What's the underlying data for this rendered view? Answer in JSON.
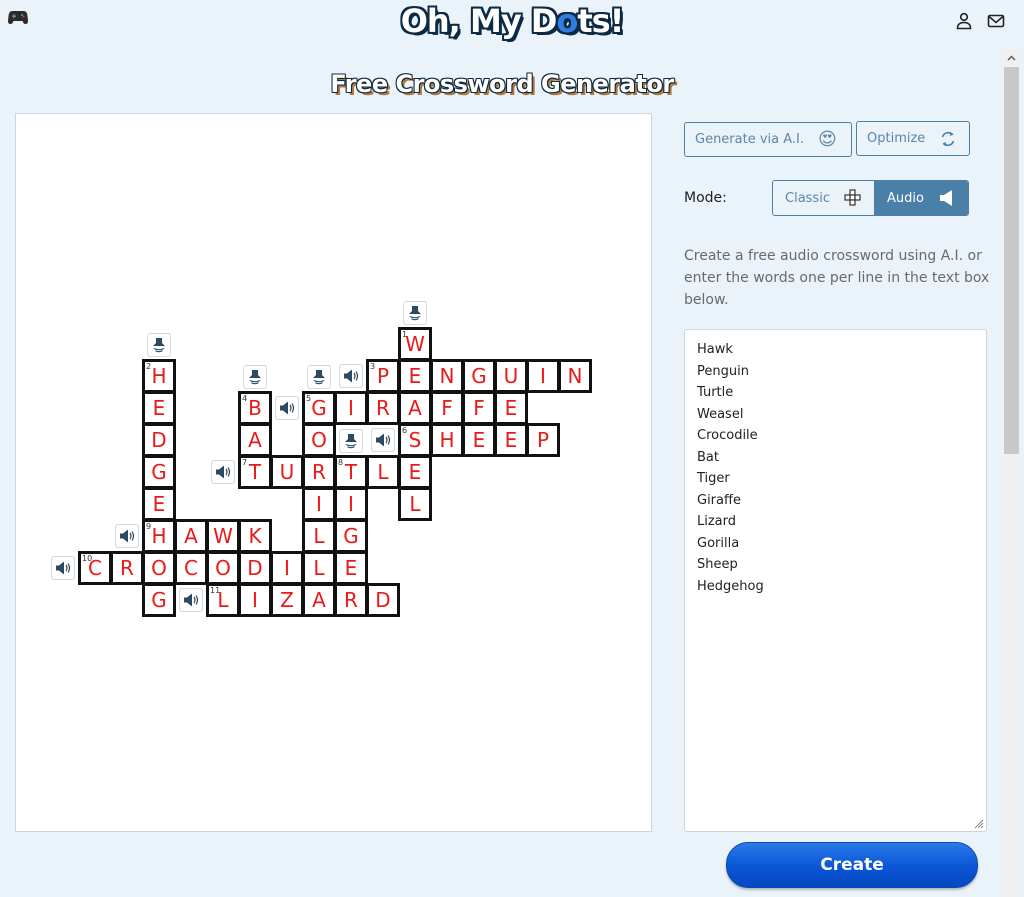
{
  "header": {
    "logo_parts": [
      "Oh, My D",
      "o",
      "ts!"
    ],
    "icons": [
      "gamepad-icon",
      "user-icon",
      "mail-icon"
    ]
  },
  "page_title": "Free Crossword Generator",
  "toolbar": {
    "generate_label": "Generate via A.I.",
    "generate_emoji": "😍",
    "optimize_label": "Optimize"
  },
  "mode": {
    "label": "Mode:",
    "options": [
      "Classic",
      "Audio"
    ],
    "selected": "Audio"
  },
  "description": "Create a free audio crossword using A.I. or enter the words one per line in the text box below.",
  "word_list": [
    "Hawk",
    "Penguin",
    "Turtle",
    "Weasel",
    "Crocodile",
    "Bat",
    "Tiger",
    "Giraffe",
    "Lizard",
    "Gorilla",
    "Sheep",
    "Hedgehog"
  ],
  "create_label": "Create",
  "colors": {
    "accent": "#4a7fa8",
    "letter": "#e81a1a",
    "create_button": "#0a55d6",
    "background": "#eaf2fa"
  },
  "crossword": {
    "words": [
      {
        "number": 1,
        "word": "WEASEL",
        "dir": "down",
        "row": 0,
        "col": 10
      },
      {
        "number": 2,
        "word": "HEDGEHOG",
        "dir": "down",
        "row": 1,
        "col": 2
      },
      {
        "number": 3,
        "word": "PENGUIN",
        "dir": "across",
        "row": 1,
        "col": 9
      },
      {
        "number": 4,
        "word": "BAT",
        "dir": "down",
        "row": 2,
        "col": 5
      },
      {
        "number": 5,
        "word": "GIRAFFE",
        "dir": "across",
        "row": 2,
        "col": 7
      },
      {
        "number": 5,
        "word": "GORILLA",
        "dir": "down",
        "row": 2,
        "col": 7
      },
      {
        "number": 6,
        "word": "SHEEP",
        "dir": "across",
        "row": 3,
        "col": 10
      },
      {
        "number": 7,
        "word": "TURTLE",
        "dir": "across",
        "row": 4,
        "col": 5
      },
      {
        "number": 8,
        "word": "TIGER",
        "dir": "down",
        "row": 4,
        "col": 8
      },
      {
        "number": 9,
        "word": "HAWK",
        "dir": "across",
        "row": 6,
        "col": 2
      },
      {
        "number": 10,
        "word": "CROCODILE",
        "dir": "across",
        "row": 7,
        "col": 0
      },
      {
        "number": 11,
        "word": "LIZARD",
        "dir": "across",
        "row": 8,
        "col": 4
      }
    ]
  }
}
